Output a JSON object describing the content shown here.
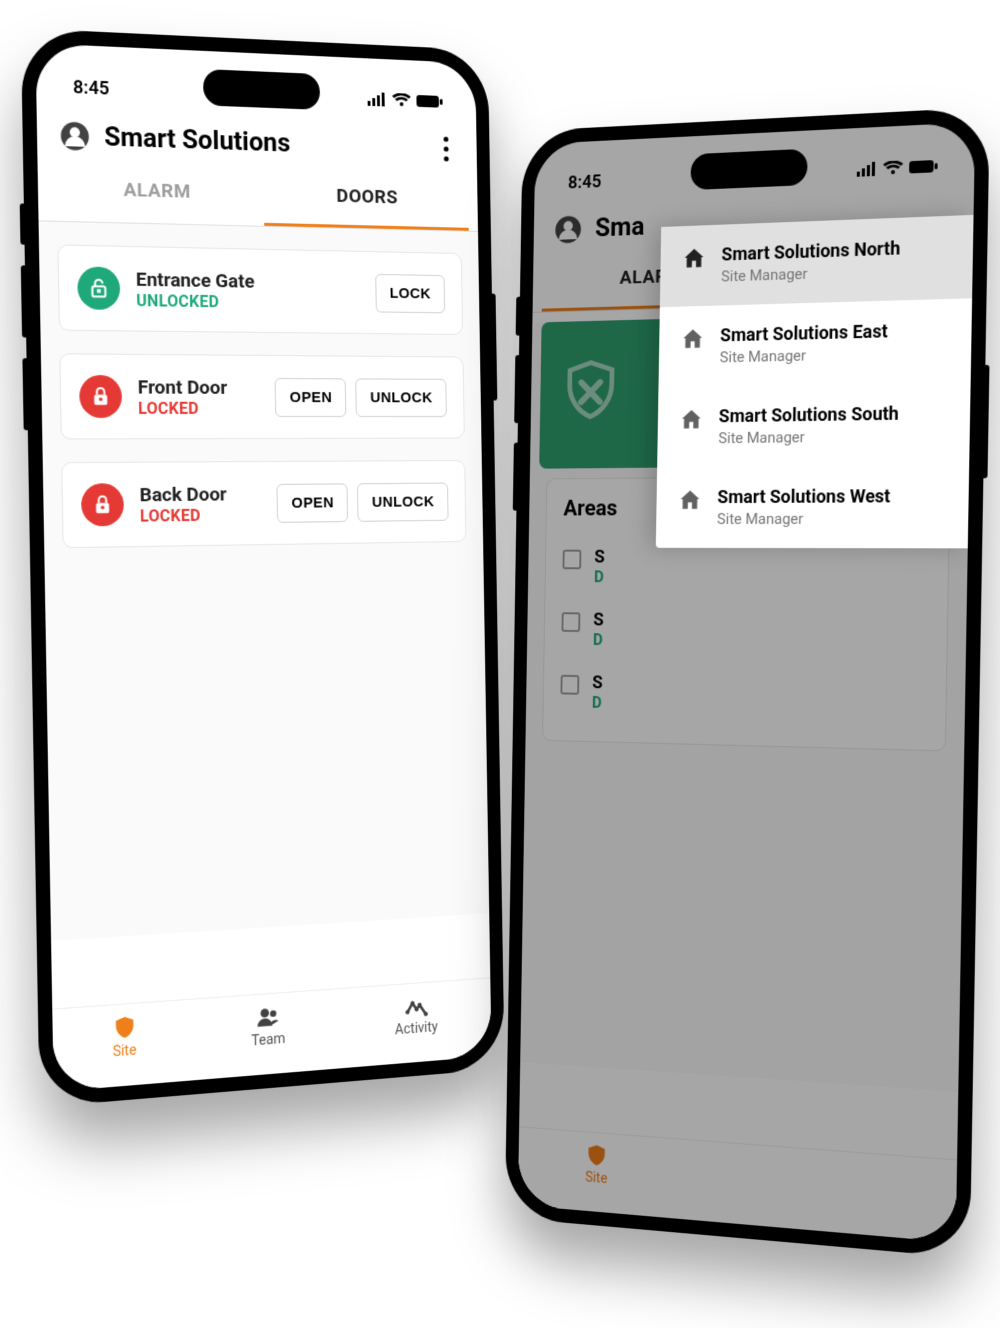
{
  "status_time": "8:45",
  "phone1": {
    "title": "Smart Solutions",
    "tabs": {
      "alarm": "ALARM",
      "doors": "DOORS"
    },
    "doors": [
      {
        "name": "Entrance Gate",
        "status": "UNLOCKED",
        "status_class": "green",
        "buttons": [
          "LOCK"
        ]
      },
      {
        "name": "Front Door",
        "status": "LOCKED",
        "status_class": "red",
        "buttons": [
          "OPEN",
          "UNLOCK"
        ]
      },
      {
        "name": "Back Door",
        "status": "LOCKED",
        "status_class": "red",
        "buttons": [
          "OPEN",
          "UNLOCK"
        ]
      }
    ],
    "nav": {
      "site": "Site",
      "team": "Team",
      "activity": "Activity"
    }
  },
  "phone2": {
    "title_partial": "Sma",
    "tabs": {
      "alarm_partial": "ALAR"
    },
    "areas_title": "Areas",
    "area_rows": [
      {
        "name_partial": "S",
        "sub_partial": "D"
      },
      {
        "name_partial": "S",
        "sub_partial": "D"
      },
      {
        "name_partial": "S",
        "sub_partial": "D"
      }
    ],
    "menu": [
      {
        "label": "Smart Solutions North",
        "sub": "Site Manager",
        "active": true
      },
      {
        "label": "Smart Solutions East",
        "sub": "Site Manager",
        "active": false
      },
      {
        "label": "Smart Solutions South",
        "sub": "Site Manager",
        "active": false
      },
      {
        "label": "Smart Solutions West",
        "sub": "Site Manager",
        "active": false
      }
    ],
    "nav": {
      "site": "Site"
    }
  }
}
